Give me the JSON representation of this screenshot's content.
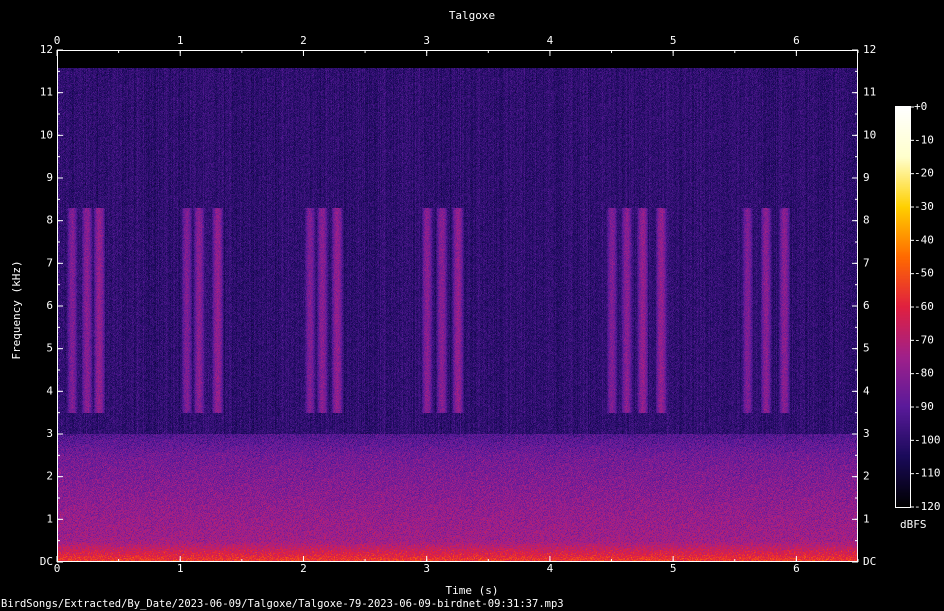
{
  "chart_data": {
    "type": "heatmap",
    "title": "Talgoxe",
    "xlabel": "Time (s)",
    "ylabel": "Frequency (kHz)",
    "xlim": [
      0,
      6.5
    ],
    "ylim": [
      0,
      12
    ],
    "x_ticks": [
      "0",
      "1",
      "2",
      "3",
      "4",
      "5",
      "6"
    ],
    "y_ticks": [
      "DC",
      "1",
      "2",
      "3",
      "4",
      "5",
      "6",
      "7",
      "8",
      "9",
      "10",
      "11",
      "12"
    ],
    "colorbar": {
      "label": "dBFS",
      "range": [
        -120,
        0
      ],
      "ticks": [
        "+0",
        "-10",
        "-20",
        "-30",
        "-40",
        "-50",
        "-60",
        "-70",
        "-80",
        "-90",
        "-100",
        "-110",
        "-120"
      ],
      "colors": [
        "#000000",
        "#1a0a5a",
        "#5a1a9a",
        "#a0208a",
        "#e02040",
        "#ff6a00",
        "#ffd000",
        "#ffffcc",
        "#ffffff"
      ]
    },
    "background_level_db": -100,
    "content_max_frequency_khz": 11.6,
    "low_frequency_energy": [
      {
        "freq_khz": 0.05,
        "db": -55
      },
      {
        "freq_khz": 0.5,
        "db": -75
      },
      {
        "freq_khz": 1.2,
        "db": -78
      },
      {
        "freq_khz": 2.5,
        "db": -85
      },
      {
        "freq_khz": 3.0,
        "db": -92
      }
    ],
    "calls": [
      {
        "t": 0.12,
        "f_low": 3.5,
        "f_high": 8.3,
        "db": -82
      },
      {
        "t": 0.24,
        "f_low": 3.5,
        "f_high": 8.3,
        "db": -80
      },
      {
        "t": 0.34,
        "f_low": 3.5,
        "f_high": 8.3,
        "db": -78
      },
      {
        "t": 1.05,
        "f_low": 3.5,
        "f_high": 8.3,
        "db": -82
      },
      {
        "t": 1.15,
        "f_low": 3.5,
        "f_high": 8.3,
        "db": -80
      },
      {
        "t": 1.3,
        "f_low": 3.5,
        "f_high": 8.3,
        "db": -78
      },
      {
        "t": 2.05,
        "f_low": 3.5,
        "f_high": 8.3,
        "db": -82
      },
      {
        "t": 2.15,
        "f_low": 3.5,
        "f_high": 8.3,
        "db": -80
      },
      {
        "t": 2.27,
        "f_low": 3.5,
        "f_high": 8.3,
        "db": -78
      },
      {
        "t": 3.0,
        "f_low": 3.5,
        "f_high": 8.3,
        "db": -80
      },
      {
        "t": 3.12,
        "f_low": 3.5,
        "f_high": 8.3,
        "db": -80
      },
      {
        "t": 3.25,
        "f_low": 3.5,
        "f_high": 8.3,
        "db": -78
      },
      {
        "t": 4.5,
        "f_low": 3.5,
        "f_high": 8.3,
        "db": -82
      },
      {
        "t": 4.62,
        "f_low": 3.5,
        "f_high": 8.3,
        "db": -80
      },
      {
        "t": 4.75,
        "f_low": 3.5,
        "f_high": 8.3,
        "db": -78
      },
      {
        "t": 4.9,
        "f_low": 3.5,
        "f_high": 8.3,
        "db": -78
      },
      {
        "t": 5.6,
        "f_low": 3.5,
        "f_high": 8.3,
        "db": -82
      },
      {
        "t": 5.75,
        "f_low": 3.5,
        "f_high": 8.3,
        "db": -80
      },
      {
        "t": 5.9,
        "f_low": 3.5,
        "f_high": 8.3,
        "db": -80
      }
    ]
  },
  "footer": "BirdSongs/Extracted/By_Date/2023-06-09/Talgoxe/Talgoxe-79-2023-06-09-birdnet-09:31:37.mp3"
}
